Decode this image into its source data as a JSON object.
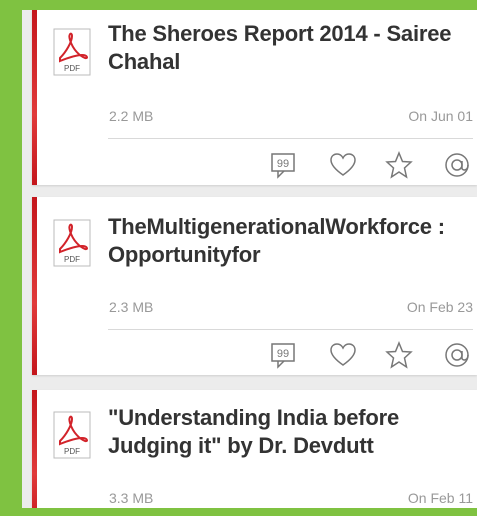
{
  "documents": [
    {
      "title": "The Sheroes Report 2014 - Sairee Chahal",
      "title_lines": [
        "The Sheroes Report 2014 - Sairee",
        "Chahal"
      ],
      "size": "2.2 MB",
      "date": "On Jun 01",
      "file_badge": "PDF"
    },
    {
      "title": "TheMultigenerationalWorkforce : Opportunityfor",
      "title_lines": [
        "TheMultigenerationalWorkforce :",
        "Opportunityfor"
      ],
      "size": "2.3 MB",
      "date": "On Feb 23",
      "file_badge": "PDF"
    },
    {
      "title": "\"Understanding India before Judging it\" by Dr. Devdutt",
      "title_lines": [
        "\"Understanding India before",
        "Judging it\" by Dr. Devdutt"
      ],
      "size": "3.3 MB",
      "date": "On Feb 11",
      "file_badge": "PDF"
    }
  ],
  "actions": [
    "quote-icon",
    "heart-icon",
    "star-icon",
    "at-icon"
  ],
  "colors": {
    "frame": "#7fc241",
    "accent_stripe": "#c4161c",
    "pdf_red": "#d2232a",
    "title_text": "#333333",
    "meta_text": "#999999"
  }
}
